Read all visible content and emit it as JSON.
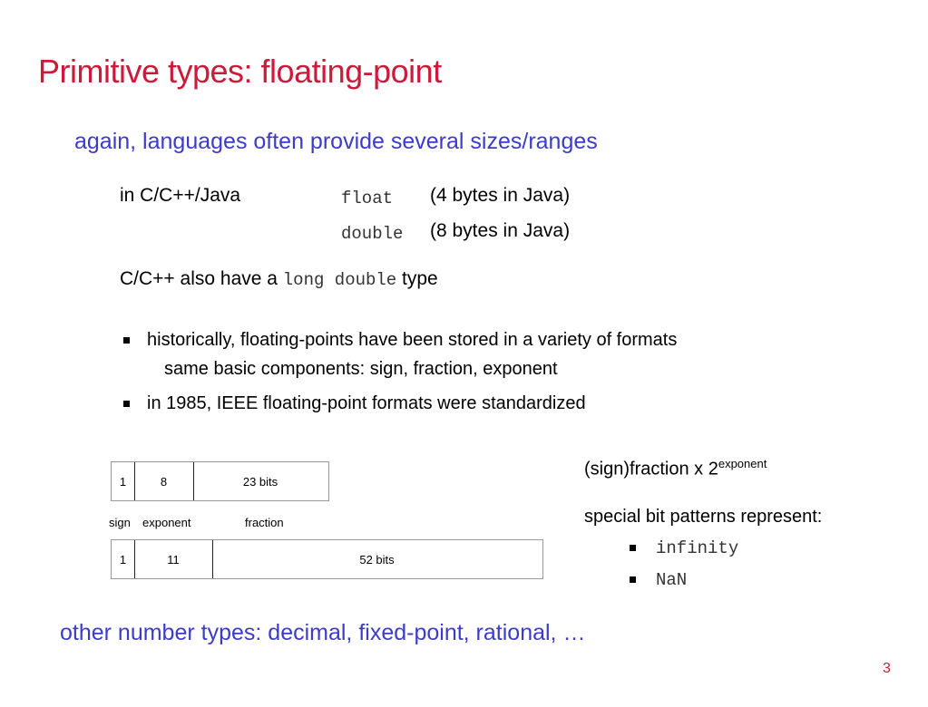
{
  "slide": {
    "title": "Primitive types: floating-point",
    "subtitle": "again, languages often provide several sizes/ranges",
    "langs_label": "in C/C++/Java",
    "float_kw": "float",
    "float_desc": "(4 bytes in Java)",
    "double_kw": "double",
    "double_desc": "(8 bytes in Java)",
    "long_double_prefix": "C/C++ also have a",
    "long_double_kw": "long double",
    "long_double_suffix": "type",
    "bullet1_line1": "historically, floating-points have been stored in a variety of formats",
    "bullet1_line2": "same basic components:  sign, fraction, exponent",
    "bullet2": "in 1985, IEEE floating-point formats were standardized",
    "formula_base": "(sign)fraction x 2",
    "formula_sup": "exponent",
    "special_label": "special bit patterns represent:",
    "special_items": [
      "infinity",
      "NaN"
    ],
    "bottom_text": "other number types: decimal, fixed-point, rational, …",
    "page_number": "3"
  },
  "diagram": {
    "single": {
      "sign": "1",
      "exponent": "8",
      "fraction": "23 bits"
    },
    "labels": {
      "sign": "sign",
      "exponent": "exponent",
      "fraction": "fraction"
    },
    "double": {
      "sign": "1",
      "exponent": "11",
      "fraction": "52 bits"
    }
  }
}
